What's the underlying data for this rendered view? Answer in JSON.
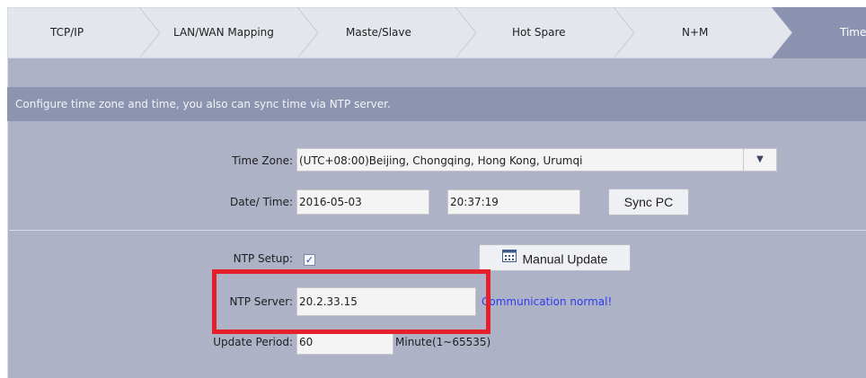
{
  "tabs": [
    {
      "label": "TCP/IP",
      "active": false
    },
    {
      "label": "LAN/WAN Mapping",
      "active": false
    },
    {
      "label": "Maste/Slave",
      "active": false
    },
    {
      "label": "Hot Spare",
      "active": false
    },
    {
      "label": "N+M",
      "active": false
    },
    {
      "label": "Time",
      "active": true
    }
  ],
  "description": "Configure time zone and time, you also can sync time via NTP server.",
  "time_zone": {
    "label": "Time Zone:",
    "value": "(UTC+08:00)Beijing, Chongqing, Hong Kong, Urumqi"
  },
  "date_time": {
    "label": "Date/ Time:",
    "date": "2016-05-03",
    "time": "20:37:19",
    "sync_label": "Sync PC"
  },
  "ntp": {
    "setup_label": "NTP Setup:",
    "checked": true,
    "manual_update_label": "Manual Update",
    "server_label": "NTP Server:",
    "server_value": "20.2.33.15",
    "status": "Communication normal!",
    "period_label": "Update Period:",
    "period_value": "60",
    "period_unit": "Minute(1~65535)"
  },
  "colors": {
    "tab_fill": "#e4e6ee",
    "tab_active": "#8b93b1",
    "panel": "#adb2c6",
    "desc_bar": "#8c94b0",
    "status_text": "#2d3cf0",
    "highlight": "#e5202a"
  }
}
